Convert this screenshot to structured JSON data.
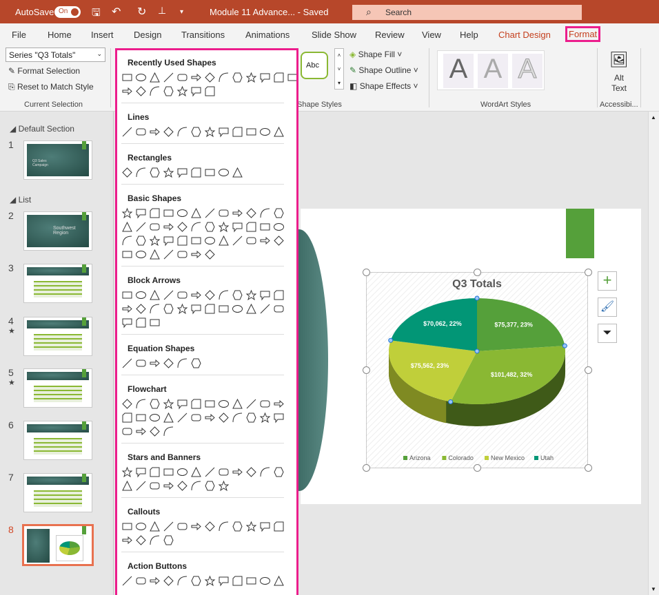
{
  "titlebar": {
    "autosave": "AutoSave",
    "toggle": "On",
    "doc": "Module 11 Advance...  -  Saved",
    "search": "Search"
  },
  "tabs": [
    "File",
    "Home",
    "Insert",
    "Design",
    "Transitions",
    "Animations",
    "Slide Show",
    "Review",
    "View",
    "Help",
    "Chart Design",
    "Format"
  ],
  "ribbon": {
    "series_select": "Series \"Q3 Totals\"",
    "format_selection": "Format Selection",
    "reset_style": "Reset to Match Style",
    "group_current": "Current Selection",
    "abc": "Abc",
    "shape_fill": "Shape Fill",
    "shape_outline": "Shape Outline",
    "shape_effects": "Shape Effects",
    "group_shape_styles": "Shape Styles",
    "group_wordart": "WordArt Styles",
    "wordart_letter": "A",
    "alt_text": "Alt Text",
    "group_access": "Accessibi..."
  },
  "slides_panel": {
    "sections": [
      "Default Section",
      "List"
    ],
    "slides": [
      {
        "n": "1",
        "title": "Q3 Sales Campaign"
      },
      {
        "n": "2",
        "title": "Southwest Region"
      },
      {
        "n": "3"
      },
      {
        "n": "4",
        "star": "★"
      },
      {
        "n": "5",
        "star": "★"
      },
      {
        "n": "6"
      },
      {
        "n": "7"
      },
      {
        "n": "8",
        "selected": true
      }
    ]
  },
  "shapes_gallery": {
    "categories": [
      {
        "name": "Recently Used Shapes",
        "rows": [
          13,
          7
        ]
      },
      {
        "name": "Lines",
        "rows": [
          12
        ]
      },
      {
        "name": "Rectangles",
        "rows": [
          9
        ]
      },
      {
        "name": "Basic Shapes",
        "rows": [
          12,
          12,
          12,
          7
        ]
      },
      {
        "name": "Block Arrows",
        "rows": [
          12,
          12,
          3
        ]
      },
      {
        "name": "Equation Shapes",
        "rows": [
          6
        ]
      },
      {
        "name": "Flowchart",
        "rows": [
          12,
          12,
          4
        ]
      },
      {
        "name": "Stars and Banners",
        "rows": [
          12,
          8
        ]
      },
      {
        "name": "Callouts",
        "rows": [
          12,
          4
        ]
      },
      {
        "name": "Action Buttons",
        "rows": [
          12
        ]
      }
    ]
  },
  "colors": {
    "title_bar": "#b7472a",
    "highlight": "#ec1d8c",
    "selected_slide": "#e8714f"
  },
  "chart_data": {
    "type": "pie",
    "title": "Q3 Totals",
    "categories": [
      "Arizona",
      "Colorado",
      "New Mexico",
      "Utah"
    ],
    "values": [
      75377,
      101482,
      75562,
      70062
    ],
    "percents": [
      23,
      32,
      23,
      22
    ],
    "labels": [
      "$75,377, 23%",
      "$101,482, 32%",
      "$75,562, 23%",
      "$70,062, 22%"
    ],
    "colors": [
      "#55a03a",
      "#8ab833",
      "#c0cf3a",
      "#029676"
    ],
    "legend": "bottom",
    "style": "3d"
  }
}
